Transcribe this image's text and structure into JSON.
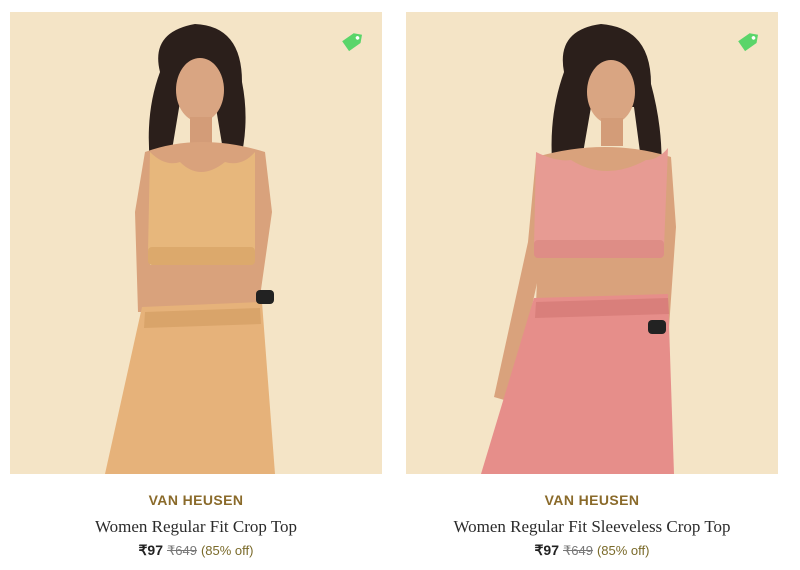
{
  "products": [
    {
      "brand": "VAN HEUSEN",
      "title": "Women Regular Fit Crop Top",
      "price": "₹97",
      "mrp": "₹649",
      "discount": "(85% off)",
      "outfit_color": "#e7b77c",
      "background_color": "#f4e4c6",
      "badge_icon": "price-tag-icon",
      "badge_color": "#5ad56a"
    },
    {
      "brand": "VAN HEUSEN",
      "title": "Women Regular Fit Sleeveless Crop Top",
      "price": "₹97",
      "mrp": "₹649",
      "discount": "(85% off)",
      "outfit_color": "#e79b93",
      "background_color": "#f4e4c6",
      "badge_icon": "price-tag-icon",
      "badge_color": "#5ad56a"
    }
  ]
}
